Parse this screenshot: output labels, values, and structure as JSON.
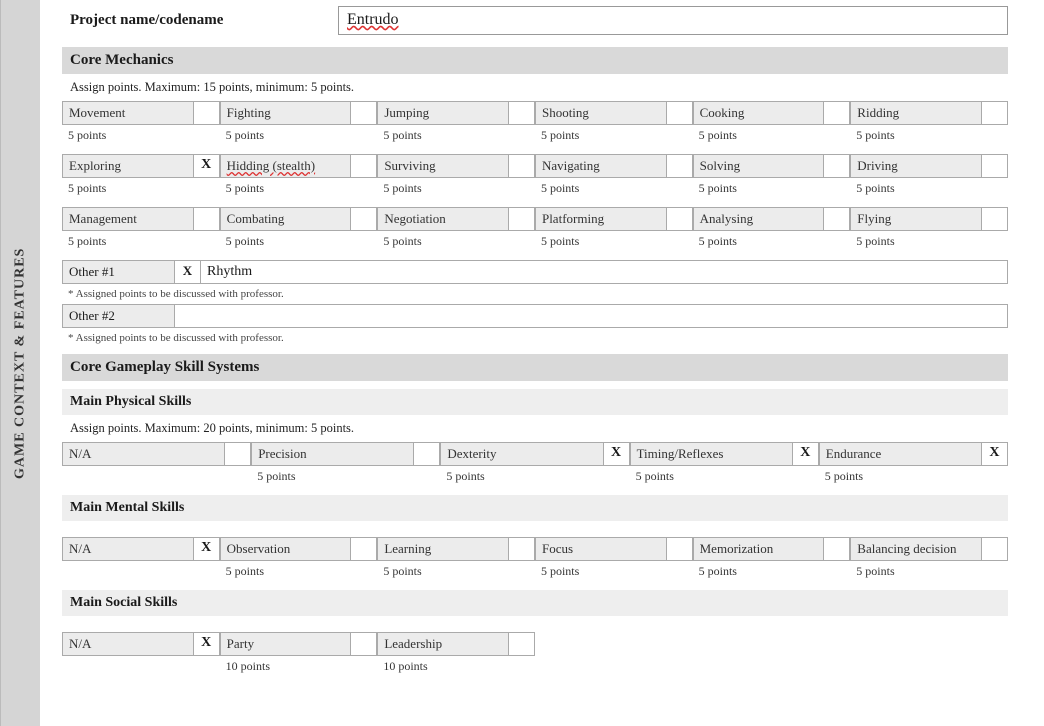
{
  "sidebar": {
    "label": "GAME CONTEXT & FEATURES"
  },
  "project": {
    "label": "Project name/codename",
    "value": "Entrudo"
  },
  "coreMechanics": {
    "header": "Core Mechanics",
    "instruction": "Assign points. Maximum: 15 points, minimum: 5 points.",
    "row1": [
      {
        "label": "Movement",
        "chk": "",
        "pts": "5 points"
      },
      {
        "label": "Fighting",
        "chk": "",
        "pts": "5 points"
      },
      {
        "label": "Jumping",
        "chk": "",
        "pts": "5 points"
      },
      {
        "label": "Shooting",
        "chk": "",
        "pts": "5 points"
      },
      {
        "label": "Cooking",
        "chk": "",
        "pts": "5 points"
      },
      {
        "label": "Ridding",
        "chk": "",
        "pts": "5 points"
      }
    ],
    "row2": [
      {
        "label": "Exploring",
        "chk": "X",
        "pts": "5 points"
      },
      {
        "label": "Hidding (stealth)",
        "chk": "",
        "pts": "5 points",
        "wavy": true
      },
      {
        "label": "Surviving",
        "chk": "",
        "pts": "5 points"
      },
      {
        "label": "Navigating",
        "chk": "",
        "pts": "5 points"
      },
      {
        "label": "Solving",
        "chk": "",
        "pts": "5 points"
      },
      {
        "label": "Driving",
        "chk": "",
        "pts": "5 points"
      }
    ],
    "row3": [
      {
        "label": "Management",
        "chk": "",
        "pts": "5 points"
      },
      {
        "label": "Combating",
        "chk": "",
        "pts": "5 points"
      },
      {
        "label": "Negotiation",
        "chk": "",
        "pts": "5 points"
      },
      {
        "label": "Platforming",
        "chk": "",
        "pts": "5 points"
      },
      {
        "label": "Analysing",
        "chk": "",
        "pts": "5 points"
      },
      {
        "label": "Flying",
        "chk": "",
        "pts": "5 points"
      }
    ],
    "other1": {
      "label": "Other #1",
      "chk": "X",
      "value": "Rhythm",
      "note": "* Assigned points to be discussed with professor."
    },
    "other2": {
      "label": "Other #2",
      "chk": "",
      "value": "",
      "note": "* Assigned points to be discussed with professor."
    }
  },
  "skillSystems": {
    "header": "Core Gameplay Skill Systems"
  },
  "physical": {
    "header": "Main Physical Skills",
    "instruction": "Assign points. Maximum: 20 points, minimum: 5 points.",
    "row": [
      {
        "label": "N/A",
        "chk": "",
        "pts": ""
      },
      {
        "label": "Precision",
        "chk": "",
        "pts": "5 points"
      },
      {
        "label": "Dexterity",
        "chk": "X",
        "pts": "5 points"
      },
      {
        "label": "Timing/Reflexes",
        "chk": "X",
        "pts": "5 points"
      },
      {
        "label": "Endurance",
        "chk": "X",
        "pts": "5 points"
      }
    ]
  },
  "mental": {
    "header": "Main Mental Skills",
    "row": [
      {
        "label": "N/A",
        "chk": "X",
        "pts": ""
      },
      {
        "label": "Observation",
        "chk": "",
        "pts": "5 points"
      },
      {
        "label": "Learning",
        "chk": "",
        "pts": "5 points"
      },
      {
        "label": "Focus",
        "chk": "",
        "pts": "5 points"
      },
      {
        "label": "Memorization",
        "chk": "",
        "pts": "5 points"
      },
      {
        "label": "Balancing decision",
        "chk": "",
        "pts": "5 points"
      }
    ]
  },
  "social": {
    "header": "Main Social Skills",
    "row": [
      {
        "label": "N/A",
        "chk": "X",
        "pts": ""
      },
      {
        "label": "Party",
        "chk": "",
        "pts": "10 points"
      },
      {
        "label": "Leadership",
        "chk": "",
        "pts": "10 points"
      }
    ]
  }
}
